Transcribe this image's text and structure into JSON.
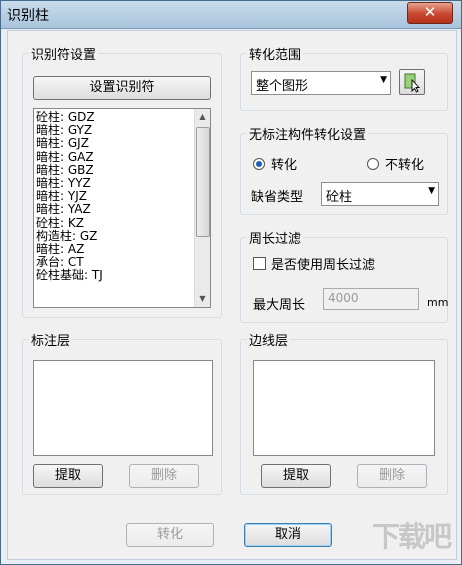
{
  "window": {
    "title": "识别柱",
    "close_symbol": "✕"
  },
  "identifier": {
    "group_label": "识别符设置",
    "set_button": "设置识别符",
    "items": [
      "砼柱: GDZ",
      "暗柱: GYZ",
      "暗柱: GJZ",
      "暗柱: GAZ",
      "暗柱: GBZ",
      "暗柱: YYZ",
      "暗柱: YJZ",
      "暗柱: YAZ",
      "砼柱: KZ",
      "构造柱: GZ",
      "暗柱: AZ",
      "承台: CT",
      "砼柱基础: TJ"
    ]
  },
  "convert_range": {
    "group_label": "转化范围",
    "selected": "整个图形"
  },
  "unmarked": {
    "group_label": "无标注构件转化设置",
    "option_convert": "转化",
    "option_no_convert": "不转化",
    "selected": "转化",
    "default_type_label": "缺省类型",
    "default_type_value": "砼柱"
  },
  "perimeter": {
    "group_label": "周长过滤",
    "checkbox_label": "是否使用周长过滤",
    "checked": false,
    "max_label": "最大周长",
    "max_value": "4000",
    "unit": "mm"
  },
  "annotation_layer": {
    "group_label": "标注层",
    "extract_button": "提取",
    "delete_button": "删除"
  },
  "edge_layer": {
    "group_label": "边线层",
    "extract_button": "提取",
    "delete_button": "删除"
  },
  "footer": {
    "convert_button": "转化",
    "cancel_button": "取消"
  },
  "watermark": "下载吧"
}
